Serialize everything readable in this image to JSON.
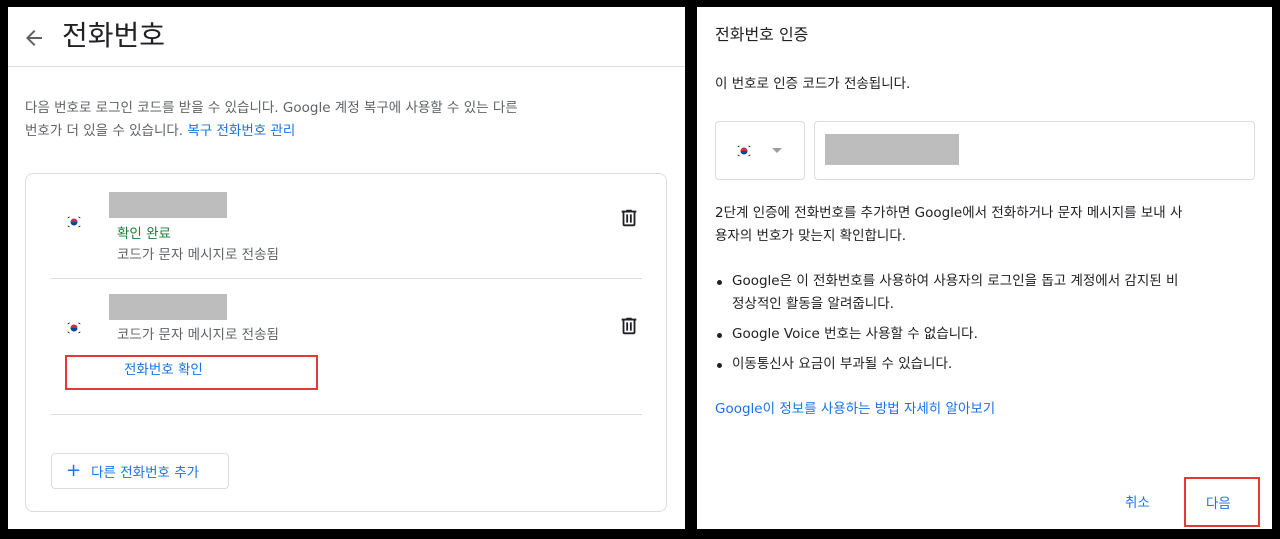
{
  "left": {
    "title": "전화번호",
    "description_line1": "다음 번호로 로그인 코드를 받을 수 있습니다. Google 계정 복구에 사용할 수 있는 다른",
    "description_line2": "번호가 더 있을 수 있습니다. ",
    "recovery_link": "복구 전화번호 관리",
    "phones": [
      {
        "status": "확인 완료",
        "delivery": "코드가 문자 메시지로 전송됨"
      },
      {
        "delivery": "코드가 문자 메시지로 전송됨",
        "verify_link": "전화번호 확인"
      }
    ],
    "add_button": {
      "icon": "plus-icon",
      "label": "다른 전화번호 추가"
    }
  },
  "right": {
    "title": "전화번호 인증",
    "subtitle": "이 번호로 인증 코드가 전송됩니다.",
    "country": "KR",
    "body_line1": "2단계 인증에 전화번호를 추가하면 Google에서 전화하거나 문자 메시지를 보내 사",
    "body_line2": "용자의 번호가 맞는지 확인합니다.",
    "bullets": [
      "Google은 이 전화번호를 사용하여 사용자의 로그인을 돕고 계정에서 감지된 비",
      "Google Voice 번호는 사용할 수 없습니다.",
      "이동통신사 요금이 부과될 수 있습니다."
    ],
    "bullet1_continued": "정상적인 활동을 알려줍니다.",
    "learn_more": "Google이 정보를 사용하는 방법 자세히 알아보기",
    "cancel": "취소",
    "next": "다음"
  },
  "colors": {
    "link": "#1a73e8",
    "verified": "#188038",
    "highlight": "#e53935",
    "redaction": "#bdbdbd"
  }
}
